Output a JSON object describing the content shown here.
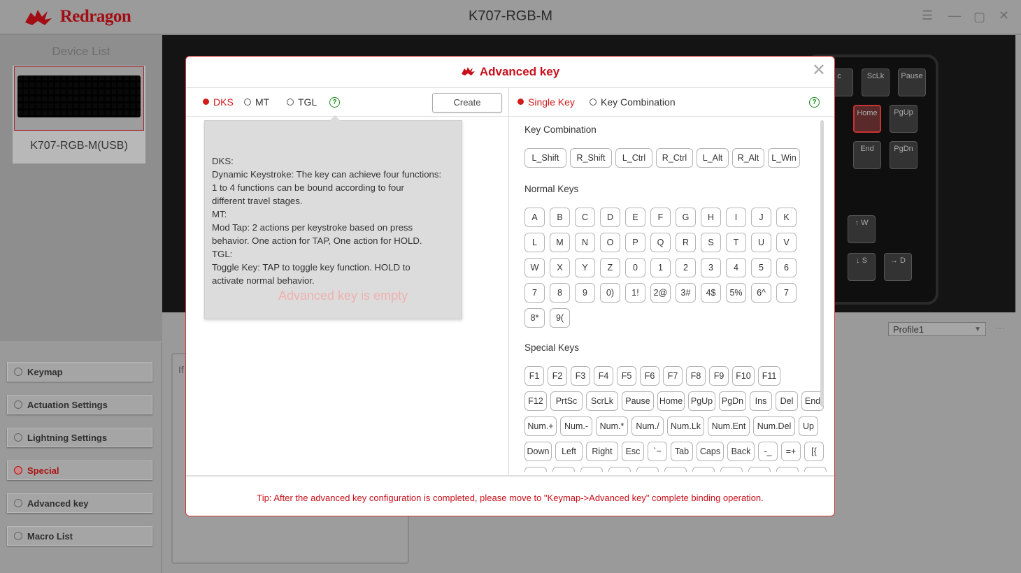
{
  "app": {
    "brand": "Redragon",
    "window_title": "K707-RGB-M",
    "controls": [
      "menu-icon",
      "minimize-icon",
      "maximize-icon",
      "close-icon"
    ]
  },
  "device_panel": {
    "title": "Device List",
    "device_name": "K707-RGB-M(USB)"
  },
  "keyboard_preview": {
    "visible_keys": [
      "c",
      "ScLk",
      "Pause",
      "Home",
      "PgUp",
      "End",
      "PgDn",
      "↑\nW",
      "↓\nS",
      "→\nD"
    ]
  },
  "profile": {
    "selected": "Profile1",
    "more": "⋯"
  },
  "nav": [
    {
      "label": "Keymap",
      "icon": "keymap-icon"
    },
    {
      "label": "Actuation Settings",
      "icon": "actuation-icon"
    },
    {
      "label": "Lightning Settings",
      "icon": "lightning-icon"
    },
    {
      "label": "Special",
      "icon": "special-icon",
      "active": true
    },
    {
      "label": "Advanced key",
      "icon": "advanced-key-icon"
    },
    {
      "label": "Macro List",
      "icon": "macro-icon"
    }
  ],
  "behind_panel": {
    "text": "If"
  },
  "dialog": {
    "title": "Advanced key",
    "close": "✕",
    "modes": [
      "DKS",
      "MT",
      "TGL"
    ],
    "selected_mode": "DKS",
    "create_label": "Create",
    "tooltip_lines": [
      "DKS:",
      "Dynamic Keystroke: The key can achieve four functions:",
      "1 to 4 functions can be bound according to four",
      "different travel stages.",
      "MT:",
      "Mod Tap: 2 actions per keystroke based on press",
      "behavior. One action for TAP, One action for HOLD.",
      "TGL:",
      "Toggle Key: TAP to toggle key function. HOLD to",
      "activate normal behavior."
    ],
    "empty_text": "Advanced key is empty",
    "key_types": [
      "Single Key",
      "Key Combination"
    ],
    "selected_key_type": "Single Key",
    "sections": {
      "combination_title": "Key Combination",
      "normal_title": "Normal Keys",
      "special_title": "Special Keys"
    },
    "combination_keys": [
      "L_Shift",
      "R_Shift",
      "L_Ctrl",
      "R_Ctrl",
      "L_Alt",
      "R_Alt",
      "L_Win"
    ],
    "normal_keys": [
      [
        "A",
        "B",
        "C",
        "D",
        "E",
        "F",
        "G",
        "H",
        "I",
        "J",
        "K"
      ],
      [
        "L",
        "M",
        "N",
        "O",
        "P",
        "Q",
        "R",
        "S",
        "T",
        "U",
        "V"
      ],
      [
        "W",
        "X",
        "Y",
        "Z",
        "0",
        "1",
        "2",
        "3",
        "4",
        "5",
        "6"
      ],
      [
        "7",
        "8",
        "9",
        "0)",
        "1!",
        "2@",
        "3#",
        "4$",
        "5%",
        "6^",
        "7"
      ],
      [
        "8*",
        "9("
      ]
    ],
    "special_keys": [
      [
        "F1",
        "F2",
        "F3",
        "F4",
        "F5",
        "F6",
        "F7",
        "F8",
        "F9",
        "F10",
        "F11"
      ],
      [
        "F12",
        "PrtSc",
        "ScrLk",
        "Pause",
        "Home",
        "PgUp",
        "PgDn",
        "Ins",
        "Del",
        "End"
      ],
      [
        "Num.+",
        "Num.-",
        "Num.*",
        "Num./",
        "Num.Lk",
        "Num.Ent",
        "Num.Del",
        "Up"
      ],
      [
        "Down",
        "Left",
        "Right",
        "Esc",
        "`~",
        "Tab",
        "Caps",
        "Back",
        "-_",
        "=+",
        "[{"
      ]
    ],
    "footer_tip": "Tip: After the advanced key configuration is completed, please move to \"Keymap->Advanced key\" complete binding operation."
  }
}
